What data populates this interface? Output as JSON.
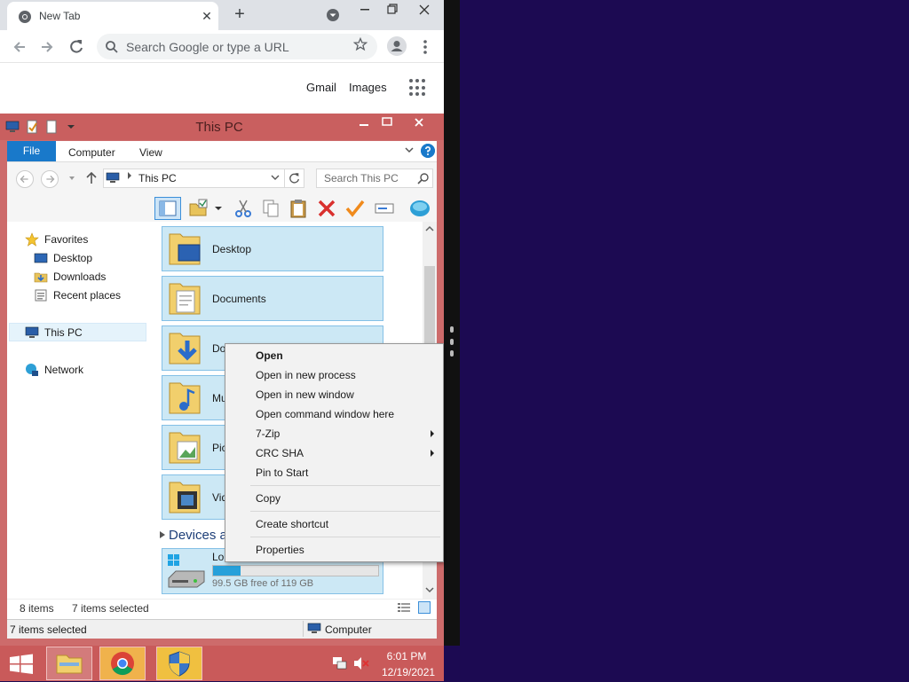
{
  "chrome": {
    "tab_title": "New Tab",
    "close_glyph": "✕",
    "newtab_glyph": "+",
    "omnibox_placeholder": "Search Google or type a URL",
    "gmail": "Gmail",
    "images": "Images",
    "icons": [
      "chrome-logo-icon",
      "back-arrow-icon",
      "forward-arrow-icon",
      "reload-icon",
      "search-icon",
      "star-icon",
      "account-icon",
      "kebab-menu-icon",
      "apps-grid-icon"
    ]
  },
  "explorer": {
    "title": "This PC",
    "ribbon_tabs": [
      "File",
      "Computer",
      "View"
    ],
    "address": "This PC",
    "search_placeholder": "Search This PC",
    "nav_pane": {
      "favorites": "Favorites",
      "desktop": "Desktop",
      "downloads": "Downloads",
      "recent_places": "Recent places",
      "this_pc": "This PC",
      "network": "Network"
    },
    "folders": [
      "Desktop",
      "Documents",
      "Do",
      "Mu",
      "Pic",
      "Vid"
    ],
    "devices_header": "Devices a",
    "drive": {
      "label": "Lo",
      "free_text": "99.5 GB free of 119 GB",
      "used_fraction": 0.164
    },
    "status_items": "8 items",
    "status_selected": "7 items selected",
    "bottom_status": "7 items selected",
    "bottom_zone": "Computer"
  },
  "context_menu": {
    "open": "Open",
    "open_new_process": "Open in new process",
    "open_new_window": "Open in new window",
    "open_cmd": "Open command window here",
    "seven_zip": "7-Zip",
    "crc_sha": "CRC SHA",
    "pin_start": "Pin to Start",
    "copy": "Copy",
    "create_shortcut": "Create shortcut",
    "properties": "Properties"
  },
  "taskbar": {
    "time": "6:01 PM",
    "date": "12/19/2021"
  },
  "colors": {
    "explorer_frame": "#cd6b6b",
    "selection": "#cce8f5",
    "accent": "#1979ca",
    "desktop": "#1c0a52"
  }
}
